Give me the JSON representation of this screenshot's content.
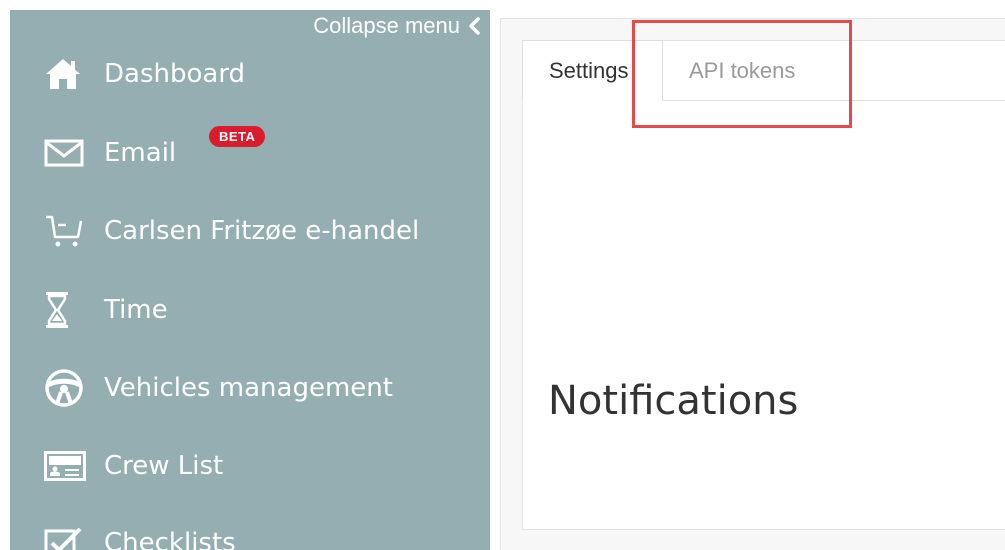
{
  "sidebar": {
    "collapse_label": "Collapse menu",
    "items": [
      {
        "label": "Dashboard",
        "icon": "home-icon"
      },
      {
        "label": "Email",
        "icon": "envelope-icon",
        "badge": "BETA"
      },
      {
        "label": "Carlsen Fritzøe e-handel",
        "icon": "cart-icon"
      },
      {
        "label": "Time",
        "icon": "hourglass-icon"
      },
      {
        "label": "Vehicles management",
        "icon": "steering-wheel-icon"
      },
      {
        "label": "Crew List",
        "icon": "id-card-icon"
      },
      {
        "label": "Checklists",
        "icon": "checklist-icon"
      }
    ]
  },
  "tabs": [
    {
      "label": "Settings",
      "active": true
    },
    {
      "label": "API tokens",
      "active": false
    }
  ],
  "main": {
    "heading": "Notifications"
  },
  "colors": {
    "sidebar_bg": "#95aeb2",
    "badge_bg": "#d91d2c",
    "highlight_border": "#e34a4a"
  }
}
